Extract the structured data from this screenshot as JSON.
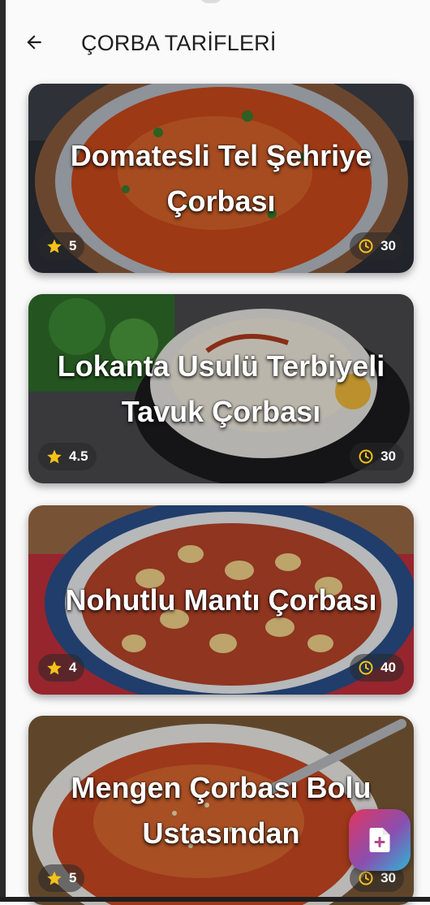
{
  "app_bar": {
    "title": "ÇORBA TARİFLERİ",
    "back_icon": "arrow-back-icon"
  },
  "recipes": [
    {
      "title": "Domatesli Tel Şehriye Çorbası",
      "rating": "5",
      "time": "30"
    },
    {
      "title": "Lokanta Usulü Terbiyeli Tavuk Çorbası",
      "rating": "4.5",
      "time": "30"
    },
    {
      "title": "Nohutlu Mantı Çorbası",
      "rating": "4",
      "time": "40"
    },
    {
      "title": "Mengen Çorbası Bolu Ustasından",
      "rating": "5",
      "time": "30"
    }
  ],
  "fab": {
    "icon": "add-document-icon"
  },
  "colors": {
    "star": "#f6c21a",
    "clock": "#f6c21a",
    "fab_gradient": [
      "#e0355f",
      "#8a4fb0",
      "#2bb6d6"
    ]
  }
}
